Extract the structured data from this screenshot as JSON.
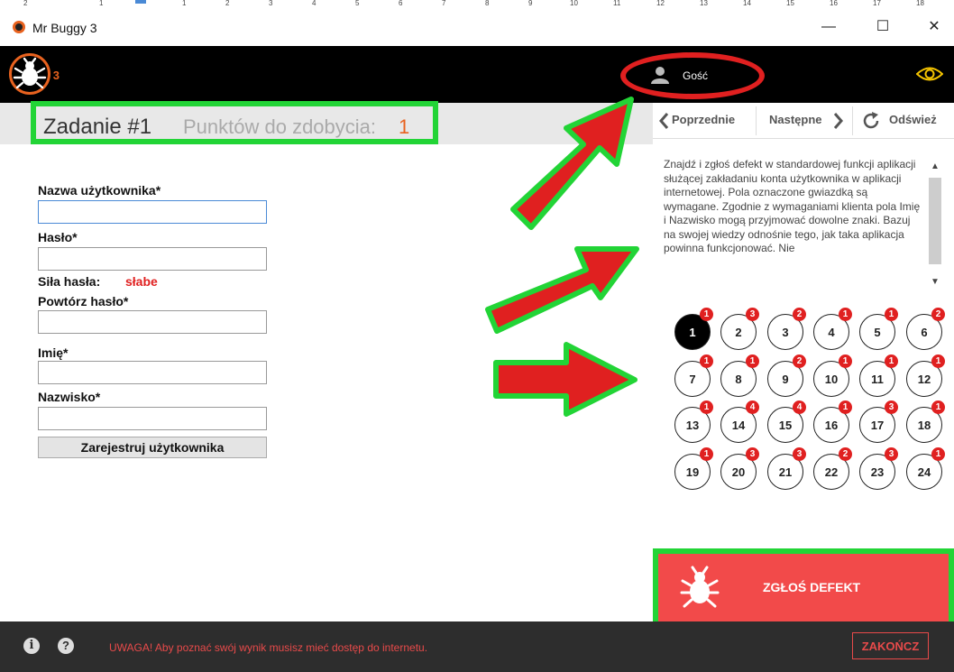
{
  "ruler": {
    "ticks": [
      "2",
      "1",
      "1",
      "2",
      "3",
      "4",
      "5",
      "6",
      "7",
      "8",
      "9",
      "10",
      "11",
      "12",
      "13",
      "14",
      "15",
      "16",
      "17",
      "18"
    ]
  },
  "window": {
    "title": "Mr Buggy 3",
    "minimize": "—",
    "maximize": "☐",
    "close": "✕"
  },
  "header": {
    "logo_number": "3",
    "user_name": "Gość"
  },
  "task": {
    "title": "Zadanie #1",
    "points_label": "Punktów do zdobycia:",
    "points_value": "1"
  },
  "nav": {
    "prev_label": "Poprzednie",
    "next_label": "Następne",
    "refresh_label": "Odśwież"
  },
  "form": {
    "username_label": "Nazwa użytkownika*",
    "password_label": "Hasło*",
    "strength_label": "Siła hasła:",
    "strength_value": "słabe",
    "repeat_label": "Powtórz hasło*",
    "firstname_label": "Imię*",
    "lastname_label": "Nazwisko*",
    "register_button": "Zarejestruj użytkownika"
  },
  "description": "Znajdź i zgłoś defekt w standardowej funkcji aplikacji służącej zakładaniu konta użytkownika w aplikacji internetowej. Pola oznaczone gwiazdką są wymagane. Zgodnie z wymaganiami klienta pola Imię i Nazwisko mogą przyjmować dowolne znaki. Bazuj na swojej wiedzy odnośnie tego, jak taka aplikacja powinna funkcjonować. Nie",
  "tasks": [
    {
      "n": "1",
      "badge": "1",
      "active": true
    },
    {
      "n": "2",
      "badge": "3"
    },
    {
      "n": "3",
      "badge": "2"
    },
    {
      "n": "4",
      "badge": "1"
    },
    {
      "n": "5",
      "badge": "1"
    },
    {
      "n": "6",
      "badge": "2"
    },
    {
      "n": "7",
      "badge": "1"
    },
    {
      "n": "8",
      "badge": "1"
    },
    {
      "n": "9",
      "badge": "2"
    },
    {
      "n": "10",
      "badge": "1"
    },
    {
      "n": "11",
      "badge": "1"
    },
    {
      "n": "12",
      "badge": "1"
    },
    {
      "n": "13",
      "badge": "1"
    },
    {
      "n": "14",
      "badge": "4"
    },
    {
      "n": "15",
      "badge": "4"
    },
    {
      "n": "16",
      "badge": "1"
    },
    {
      "n": "17",
      "badge": "3"
    },
    {
      "n": "18",
      "badge": "1"
    },
    {
      "n": "19",
      "badge": "1"
    },
    {
      "n": "20",
      "badge": "3"
    },
    {
      "n": "21",
      "badge": "3"
    },
    {
      "n": "22",
      "badge": "2"
    },
    {
      "n": "23",
      "badge": "3"
    },
    {
      "n": "24",
      "badge": "1"
    }
  ],
  "report": {
    "label": "ZGŁOŚ DEFEKT"
  },
  "footer": {
    "warning": "UWAGA! Aby poznać swój wynik musisz mieć dostęp do internetu.",
    "end_button": "ZAKOŃCZ"
  },
  "colors": {
    "accent_orange": "#e8621f",
    "highlight_green": "#22d436",
    "highlight_red": "#e02020",
    "report_red": "#f24a4a"
  },
  "icons": [
    "bug-logo-icon",
    "user-icon",
    "eye-icon",
    "chevron-left-icon",
    "chevron-right-icon",
    "refresh-icon",
    "info-icon",
    "help-icon",
    "bug-icon"
  ]
}
